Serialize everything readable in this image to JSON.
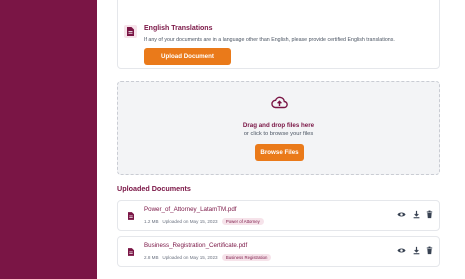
{
  "translations": {
    "title": "English Translations",
    "description": "If any of your documents are in a language other than English, please provide certified English translations.",
    "upload_label": "Upload Document"
  },
  "dropzone": {
    "title": "Drag and drop files here",
    "subtitle": "or click to browse your files",
    "browse_label": "Browse Files"
  },
  "uploaded": {
    "heading": "Uploaded Documents",
    "files": [
      {
        "name": "Power_of_Attorney_LatamTM.pdf",
        "size": "1.2 MB",
        "date": "Uploaded on May 15, 2023",
        "tag": "Power of Attorney"
      },
      {
        "name": "Business_Registration_Certificate.pdf",
        "size": "2.8 MB",
        "date": "Uploaded on May 15, 2023",
        "tag": "Business Registration"
      }
    ]
  },
  "colors": {
    "brand": "#7a1545",
    "accent": "#ea7a1a"
  },
  "icons": [
    "document-icon",
    "upload-cloud-icon",
    "eye-icon",
    "download-icon",
    "trash-icon"
  ]
}
